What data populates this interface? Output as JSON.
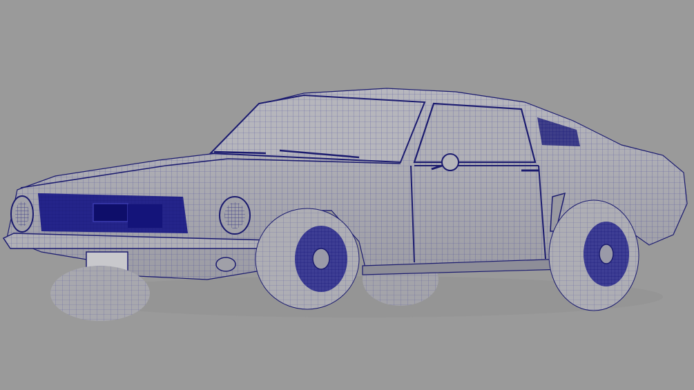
{
  "viewport": {
    "background_color": "#9a9a9a",
    "subject": "classic-fastback-car-wireframe",
    "shaded_surface_color": "#a8a8ad",
    "wireframe_color": "#1f1f8f",
    "dense_mesh_color": "#1a1a7a",
    "shadow_color": "#6e6e76"
  }
}
